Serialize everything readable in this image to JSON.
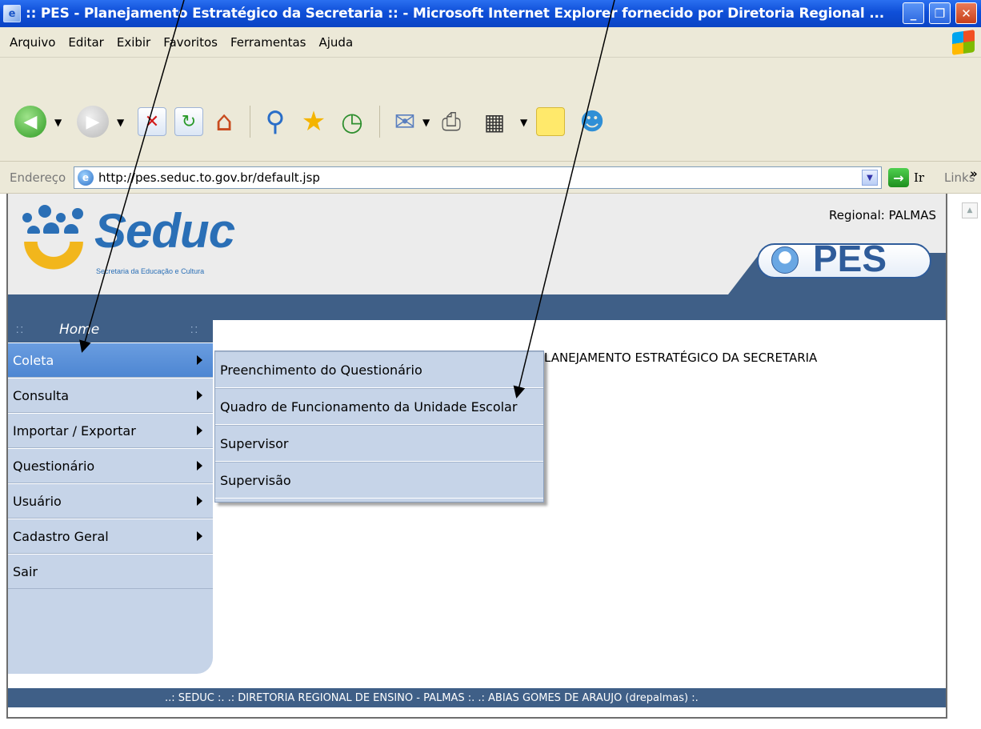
{
  "window": {
    "title": ":: PES - Planejamento Estratégico da Secretaria :: - Microsoft Internet Explorer fornecido por Diretoria Regional ...",
    "minimize_glyph": "_",
    "maximize_glyph": "❐",
    "close_glyph": "✕"
  },
  "menubar": {
    "items": [
      "Arquivo",
      "Editar",
      "Exibir",
      "Favoritos",
      "Ferramentas",
      "Ajuda"
    ]
  },
  "toolbar": {
    "icons": [
      "back-icon",
      "forward-icon",
      "stop-icon",
      "refresh-icon",
      "home-icon",
      "search-icon",
      "favorites-icon",
      "history-icon",
      "mail-icon",
      "print-icon",
      "edit-icon",
      "note-icon",
      "messenger-icon"
    ]
  },
  "address": {
    "label": "Endereço",
    "url": "http://pes.seduc.to.gov.br/default.jsp",
    "go_label": "Ir",
    "links_label": "Links",
    "links_chevron": "»"
  },
  "site": {
    "logo_name": "Seduc",
    "logo_tagline": "Secretaria da Educação e Cultura",
    "regional": "Regional: PALMAS",
    "badge": "PES",
    "home_label": "Home",
    "page_title": "LANEJAMENTO ESTRATÉGICO DA SECRETARIA",
    "footer": "..: SEDUC :. .: DIRETORIA REGIONAL DE ENSINO - PALMAS :. .: ABIAS GOMES DE ARAUJO (drepalmas) :."
  },
  "sidebar_menu": [
    {
      "label": "Coleta",
      "has_submenu": true,
      "active": true
    },
    {
      "label": "Consulta",
      "has_submenu": true
    },
    {
      "label": "Importar / Exportar",
      "has_submenu": true
    },
    {
      "label": "Questionário",
      "has_submenu": true
    },
    {
      "label": "Usuário",
      "has_submenu": true
    },
    {
      "label": "Cadastro Geral",
      "has_submenu": true
    },
    {
      "label": "Sair",
      "has_submenu": false
    }
  ],
  "submenu": {
    "items": [
      "Preenchimento do Questionário",
      "Quadro de Funcionamento da Unidade Escolar",
      "Supervisor",
      "Supervisão"
    ]
  },
  "colors": {
    "titlebar_blue": "#0f4fd8",
    "chrome_beige": "#ece9d8",
    "site_navy": "#3f5f87",
    "menu_light_blue": "#c6d4e8",
    "menu_active_blue": "#4d86d2",
    "logo_blue": "#2a6fb6",
    "logo_yellow": "#f2b61c"
  }
}
